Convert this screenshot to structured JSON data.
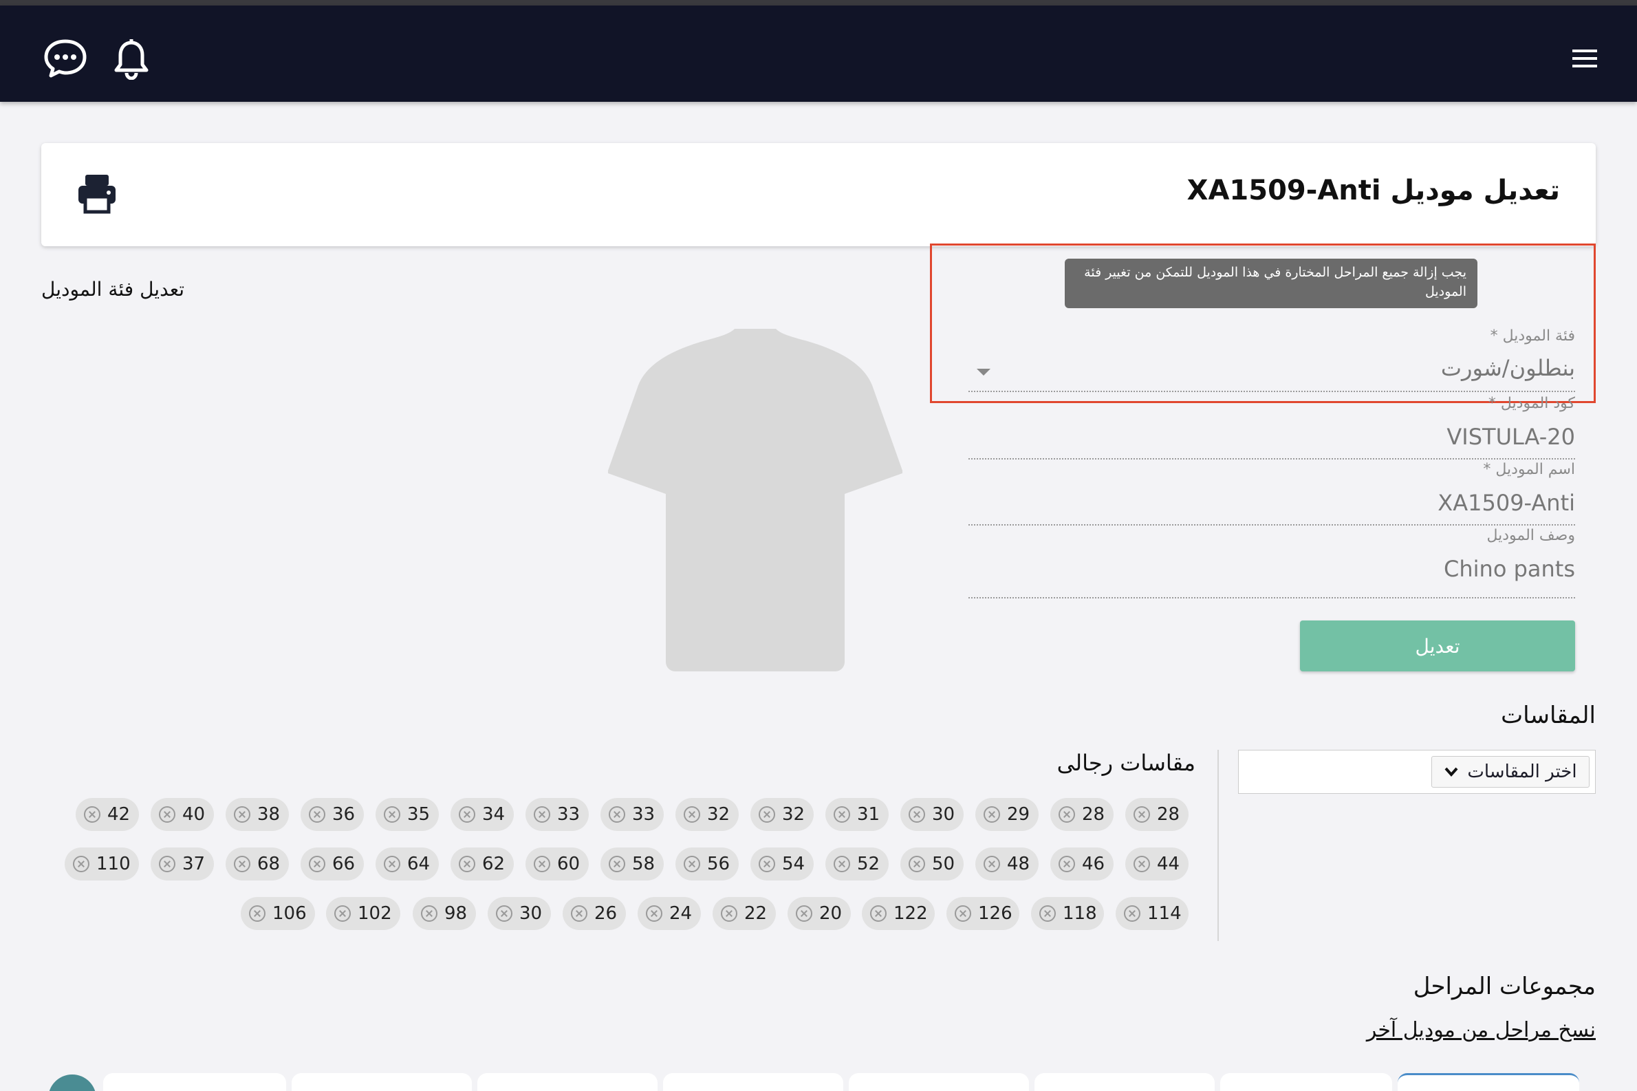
{
  "navbar": {
    "chat_icon": "chat-bubble-icon",
    "bell_icon": "bell-icon",
    "menu_icon": "hamburger-menu-icon"
  },
  "header": {
    "title": "تعديل موديل XA1509-Anti",
    "print_icon": "printer-icon"
  },
  "left": {
    "edit_category_link": "تعديل فئة الموديل"
  },
  "warning": {
    "tooltip": "يجب إزالة جميع المراحل المختارة في هذا الموديل للتمكن من تغيير فئة الموديل"
  },
  "form": {
    "category": {
      "label": "فئة الموديل *",
      "value": "بنطلون/شورت"
    },
    "code": {
      "label": "كود الموديل *",
      "value": "VISTULA-20"
    },
    "name": {
      "label": "اسم الموديل *",
      "value": "XA1509-Anti"
    },
    "description": {
      "label": "وصف الموديل",
      "value": "Chino pants"
    },
    "submit_label": "تعديل"
  },
  "sizes": {
    "title": "المقاسات",
    "select_label": "اختر المقاسات",
    "group_title": "مقاسات رجالى",
    "rows": [
      [
        "28",
        "28",
        "29",
        "30",
        "31",
        "32",
        "32",
        "33",
        "33",
        "34",
        "35",
        "36",
        "38",
        "40",
        "42"
      ],
      [
        "44",
        "46",
        "48",
        "50",
        "52",
        "54",
        "56",
        "58",
        "60",
        "62",
        "64",
        "66",
        "68",
        "37",
        "110"
      ],
      [
        "114",
        "118",
        "126",
        "122",
        "20",
        "22",
        "24",
        "26",
        "30",
        "98",
        "102",
        "106"
      ]
    ]
  },
  "stages": {
    "title": "مجموعات المراحل",
    "copy_link": "نسخ مراحل من موديل آخر"
  }
}
